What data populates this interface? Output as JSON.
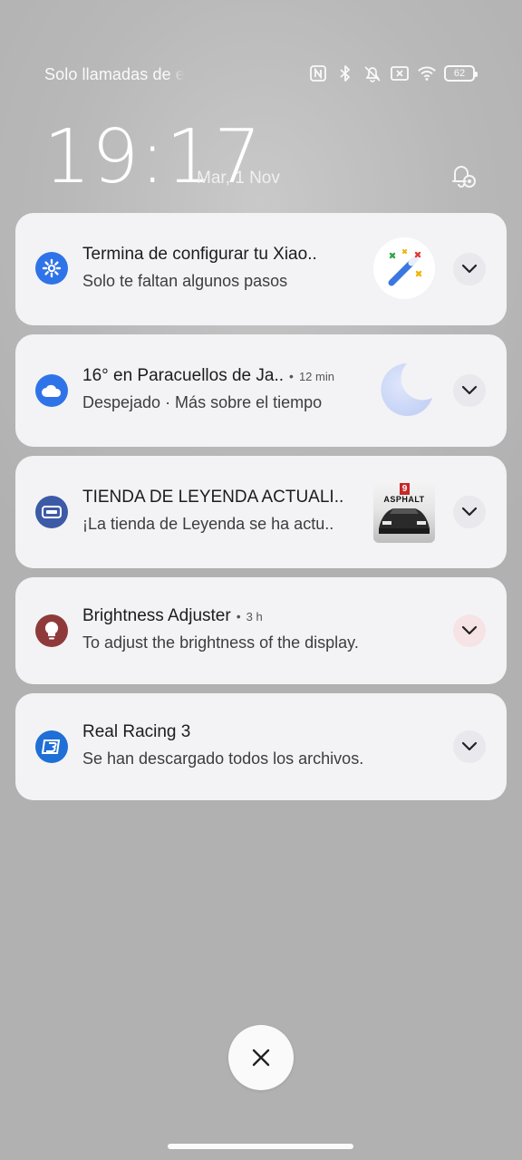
{
  "status_bar": {
    "carrier_text": "Solo llamadas de e",
    "battery_level": "62",
    "icons": [
      "nfc-icon",
      "bluetooth-icon",
      "muted-vibrate-icon",
      "no-sim-icon",
      "wifi-icon",
      "battery-icon"
    ]
  },
  "lockscreen": {
    "time": "19:17",
    "date": "Mar, 1 Nov"
  },
  "notifications": [
    {
      "app_icon": "settings-gear-icon",
      "icon_color": "#2f73e8",
      "title": "Termina de configurar tu Xiao..",
      "body": "Solo te faltan algunos pasos",
      "thumb": "magic-wand-icon"
    },
    {
      "app_icon": "weather-cloud-icon",
      "icon_color": "#2f73e8",
      "title": "16° en Paracuellos de Ja..",
      "time": "12 min",
      "body": "Despejado · Más sobre el tiempo",
      "thumb": "moon-icon"
    },
    {
      "app_icon": "game-center-icon",
      "icon_color": "#3c5aa6",
      "title": "TIENDA DE LEYENDA ACTUALI..",
      "body": "¡La tienda de Leyenda se ha actu..",
      "thumb": "asphalt-9-thumbnail",
      "thumb_text_top": "9",
      "thumb_text": "ASPHALT"
    },
    {
      "app_icon": "lightbulb-icon",
      "icon_color": "#8f3a3a",
      "title": "Brightness Adjuster",
      "time": "3 h",
      "body": "To adjust the brightness of the display."
    },
    {
      "app_icon": "real-racing-3-icon",
      "icon_color": "#1f6fd6",
      "title": "Real Racing 3",
      "body": "Se han descargado todos los archivos."
    }
  ],
  "actions": {
    "clear_all": "close-icon"
  }
}
